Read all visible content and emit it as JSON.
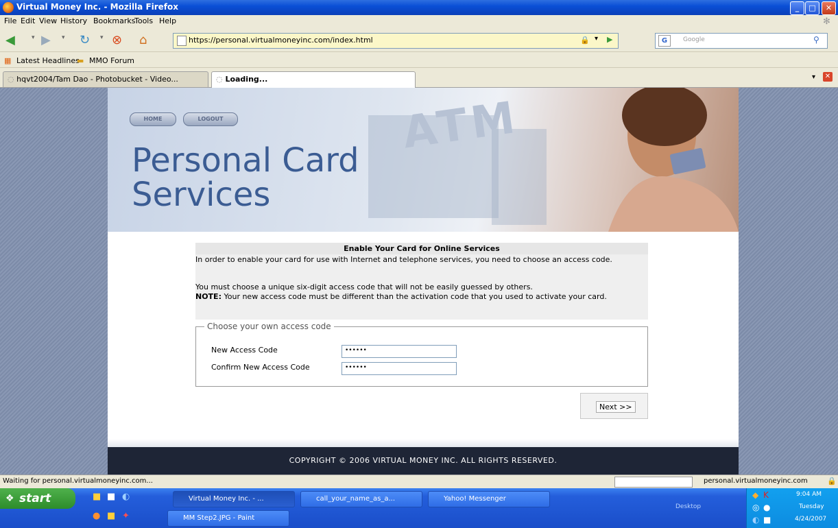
{
  "window": {
    "title": "Virtual Money Inc. - Mozilla Firefox",
    "minimize": "_",
    "maximize": "□",
    "close": "✕"
  },
  "menu": [
    "File",
    "Edit",
    "View",
    "History",
    "Bookmarks",
    "Tools",
    "Help"
  ],
  "nav": {
    "url": "https://personal.virtualmoneyinc.com/index.html",
    "search_placeholder": "Google"
  },
  "bookmarks": [
    "Latest Headlines",
    "MMO Forum"
  ],
  "tabs": [
    "hqvt2004/Tam Dao - Photobucket - Video...",
    "Loading..."
  ],
  "banner": {
    "buttons": [
      "HOME",
      "LOGOUT"
    ],
    "title_line1": "Personal Card",
    "title_line2": "Services",
    "bg_word": "ATM"
  },
  "form": {
    "heading": "Enable Your Card for Online Services",
    "para1": "In order to enable your card for use with Internet and telephone services, you need to choose an access code.",
    "para2": "You must choose a unique six-digit access code that will not be easily guessed by others.",
    "note_label": "NOTE:",
    "note_text": " Your new access code must be different than the activation code that you used to activate your card.",
    "legend": "Choose your own access code",
    "new_code_label": "New Access Code",
    "new_code_value": "••••••",
    "confirm_label": "Confirm New Access Code",
    "confirm_value": "••••••",
    "next_label": "Next >>"
  },
  "footer": "COPYRIGHT © 2006 VIRTUAL MONEY INC. ALL RIGHTS RESERVED.",
  "status": {
    "left": "Waiting for personal.virtualmoneyinc.com...",
    "right": "personal.virtualmoneyinc.com"
  },
  "taskbar": {
    "start": "start",
    "buttons": [
      "Virtual Money Inc. - ...",
      "call_your_name_as_a...",
      "Yahoo! Messenger",
      "MM Step2.JPG - Paint"
    ],
    "desktop_label": "Desktop",
    "time": "9:04 AM",
    "day": "Tuesday",
    "date": "4/24/2007"
  },
  "colors": {
    "banner_text": "#3b5c93",
    "footer_bg": "#1e2536",
    "url_bg": "#fbf7c8"
  }
}
